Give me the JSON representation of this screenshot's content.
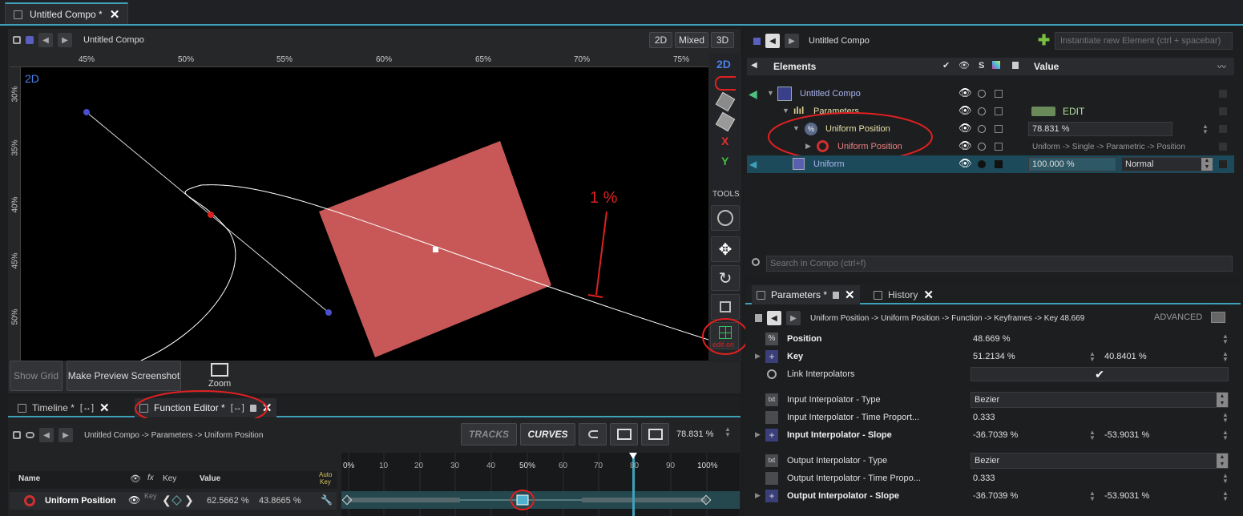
{
  "top_tab": {
    "title": "Untitled Compo *"
  },
  "viewport": {
    "toolbar_title": "Untitled Compo",
    "mode_buttons": [
      "2D",
      "Mixed",
      "3D"
    ],
    "ruler_x": [
      "45%",
      "50%",
      "55%",
      "60%",
      "65%",
      "70%",
      "75%"
    ],
    "ruler_y": [
      "30%",
      "35%",
      "40%",
      "45%",
      "50%"
    ],
    "mode_badge": "2D",
    "annotation": "1 %",
    "side_tools": {
      "label_2d": "2D",
      "x": "X",
      "y": "Y",
      "tools_label": "TOOLS",
      "edit_on": "edit on"
    },
    "bottom": {
      "show_grid": "Show Grid",
      "screenshot": "Make Preview Screenshot",
      "zoom": "Zoom"
    }
  },
  "bottom_tabs": {
    "timeline": "Timeline *",
    "function_editor": "Function Editor *"
  },
  "function_editor": {
    "breadcrumb": "Untitled Compo -> Parameters -> Uniform Position",
    "tracks": "TRACKS",
    "curves": "CURVES",
    "value": "78.831 %",
    "headers": {
      "name": "Name",
      "fx": "fx",
      "key": "Key",
      "value": "Value",
      "auto_key_1": "Auto",
      "auto_key_2": "Key"
    },
    "row": {
      "name": "Uniform Position",
      "key": "Key",
      "value1": "62.5662 %",
      "value2": "43.8665 %"
    },
    "timeline_ticks": [
      "0%",
      "10",
      "20",
      "30",
      "40",
      "50%",
      "60",
      "70",
      "80",
      "90",
      "100%"
    ]
  },
  "elements": {
    "breadcrumb": "Untitled Compo",
    "instantiate_placeholder": "Instantiate new Element (ctrl + spacebar)",
    "header_elements": "Elements",
    "header_s": "S",
    "header_value": "Value",
    "tree": [
      {
        "label": "Untitled Compo",
        "value": ""
      },
      {
        "label": "Parameters",
        "value": "EDIT"
      },
      {
        "label": "Uniform Position",
        "value": "78.831 %"
      },
      {
        "label": "Uniform Position",
        "value": "Uniform -> Single -> Parametric -> Position"
      },
      {
        "label": "Uniform",
        "value": "100.000 %",
        "blend": "Normal"
      }
    ],
    "search_placeholder": "Search in Compo (ctrl+f)"
  },
  "param_tabs": {
    "parameters": "Parameters *",
    "history": "History"
  },
  "parameters": {
    "breadcrumb": "Uniform Position -> Uniform Position -> Function -> Keyframes -> Key 48.669",
    "advanced": "ADVANCED",
    "rows": [
      {
        "label": "Position",
        "v1": "48.669 %",
        "v2": ""
      },
      {
        "label": "Key",
        "v1": "51.2134 %",
        "v2": "40.8401 %"
      },
      {
        "label": "Link Interpolators",
        "v1": "",
        "v2": ""
      },
      {
        "label": "Input Interpolator - Type",
        "v1": "Bezier",
        "v2": ""
      },
      {
        "label": "Input Interpolator - Time Proport...",
        "v1": "0.333",
        "v2": ""
      },
      {
        "label": "Input Interpolator - Slope",
        "v1": "-36.7039 %",
        "v2": "-53.9031 %"
      },
      {
        "label": "Output Interpolator - Type",
        "v1": "Bezier",
        "v2": ""
      },
      {
        "label": "Output Interpolator - Time Propo...",
        "v1": "0.333",
        "v2": ""
      },
      {
        "label": "Output Interpolator - Slope",
        "v1": "-36.7039 %",
        "v2": "-53.9031 %"
      }
    ]
  },
  "colors": {
    "accent": "#3fa0ba",
    "annotation": "#e02020",
    "square": "#c85858",
    "selection_row": "#1d4a5a"
  }
}
